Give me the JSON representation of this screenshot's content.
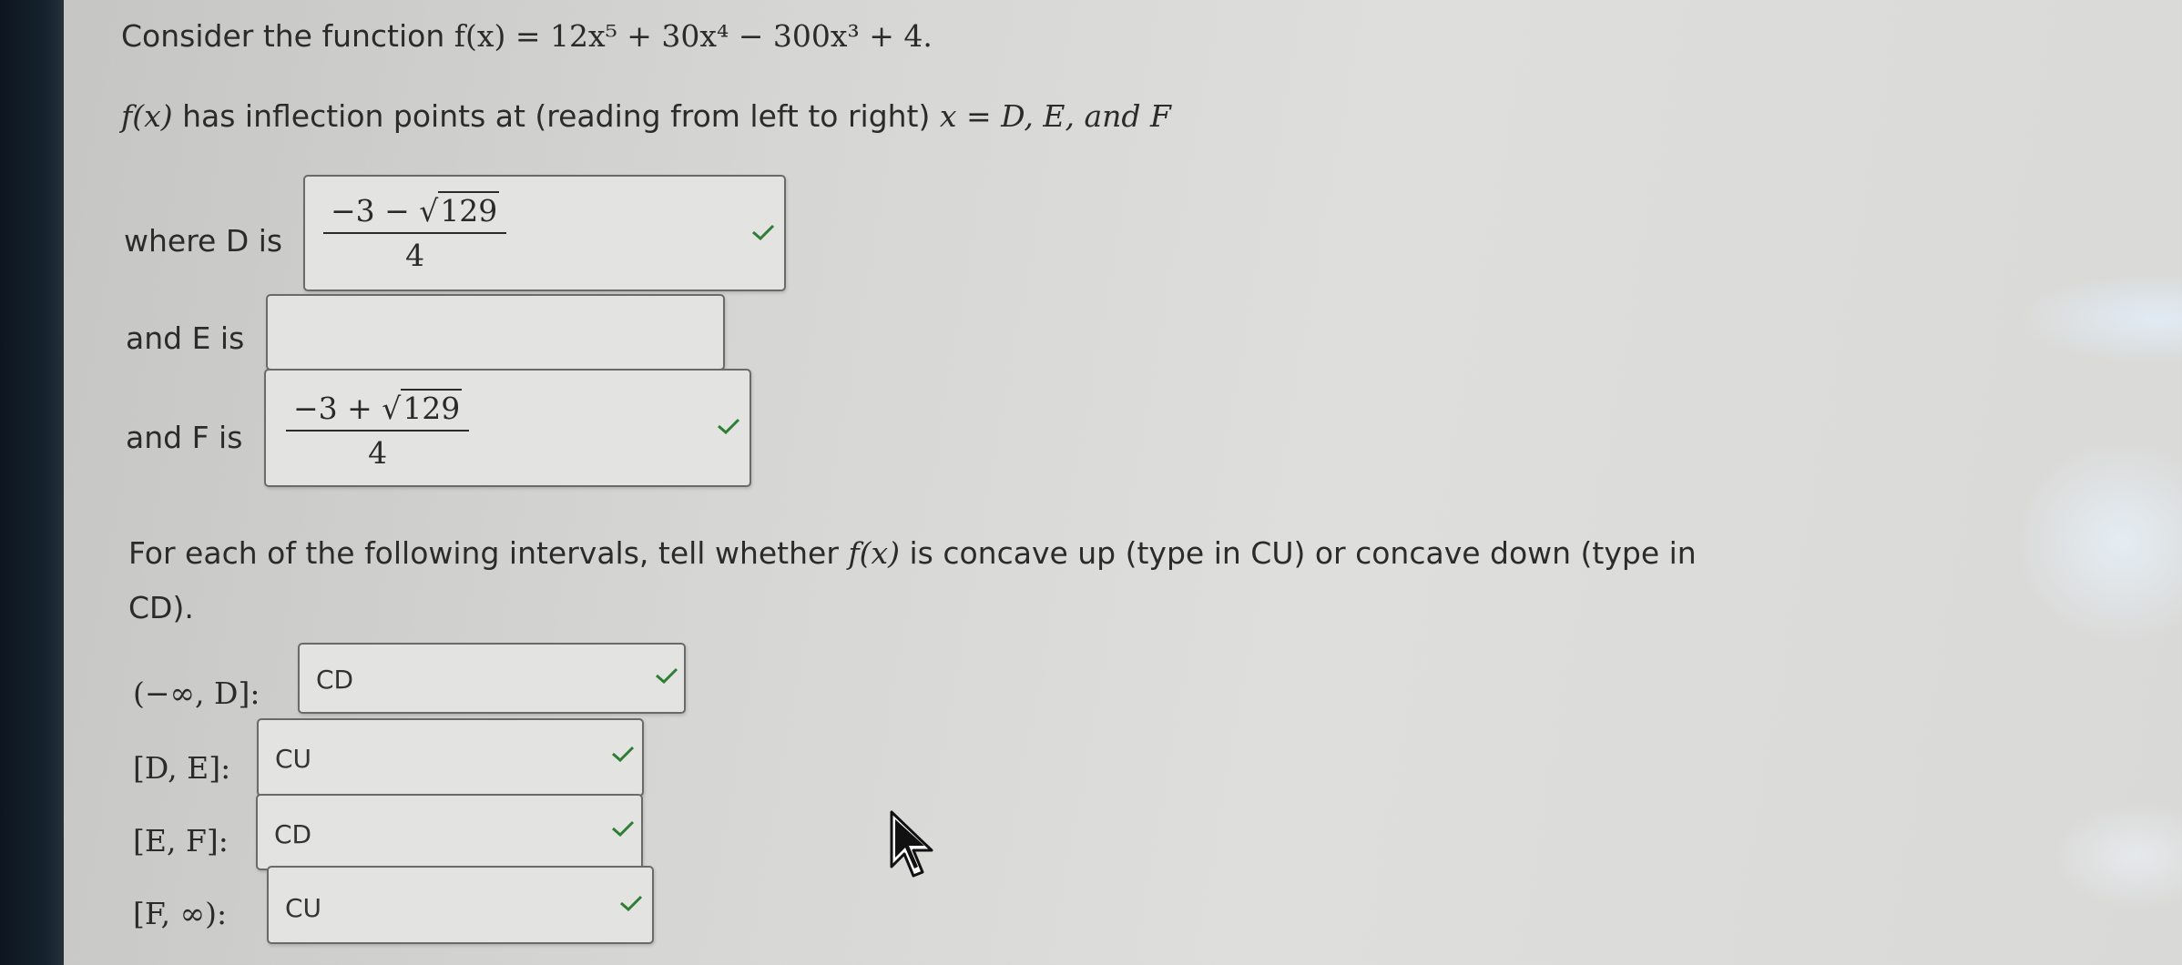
{
  "intro": {
    "prefix": "Consider the function",
    "function": "f(x) = 12x⁵ + 30x⁴ − 300x³ + 4."
  },
  "inflection": {
    "fx": "f(x)",
    "text": "has inflection points at (reading from left to right)",
    "vars": "x = D, E, and F"
  },
  "answers": {
    "d_label": "where D is",
    "d_numerator_prefix": "−3 − √",
    "d_radicand": "129",
    "d_denominator": "4",
    "e_label": "and E is",
    "e_value": "",
    "f_label": "and F is",
    "f_numerator_prefix": "−3 + √",
    "f_radicand": "129",
    "f_denominator": "4"
  },
  "concavity": {
    "prompt_a": "For each of the following intervals, tell whether",
    "prompt_fx": "f(x)",
    "prompt_b": "is concave up (type in CU) or concave down (type in",
    "prompt_c": "CD).",
    "intervals": [
      {
        "label": "(−∞, D]:",
        "value": "CD"
      },
      {
        "label": "[D, E]:",
        "value": "CU"
      },
      {
        "label": "[E, F]:",
        "value": "CD"
      },
      {
        "label": "[F, ∞):",
        "value": "CU"
      }
    ]
  },
  "colors": {
    "check": "#2e7d32",
    "border": "#6a6a6a",
    "text": "#2b2b2b"
  }
}
